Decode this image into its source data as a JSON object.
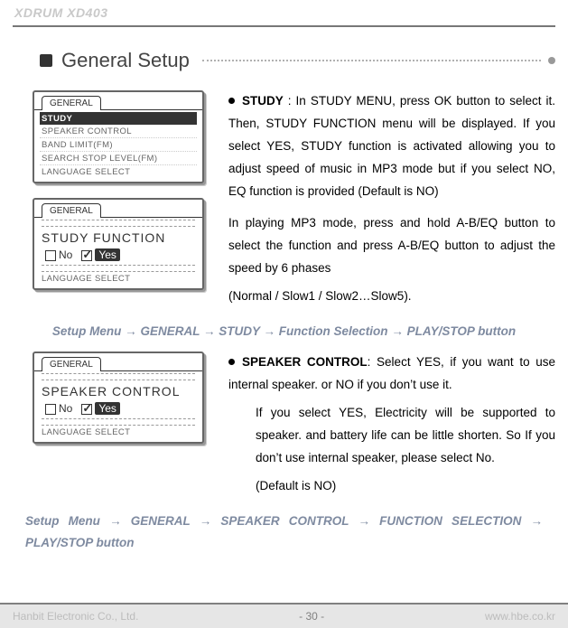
{
  "header": {
    "model": "XDRUM XD403"
  },
  "section_title": "General Setup",
  "screenshots": {
    "tab_label": "GENERAL",
    "menu_lcd": {
      "items": [
        "STUDY",
        "SPEAKER CONTROL",
        "BAND LIMIT(FM)",
        "SEARCH STOP LEVEL(FM)",
        "LANGUAGE SELECT"
      ],
      "selected_index": 0
    },
    "study_lcd": {
      "title": "STUDY FUNCTION",
      "no_label": "No",
      "yes_label": "Yes",
      "footer_item": "LANGUAGE SELECT"
    },
    "speaker_lcd": {
      "title": "SPEAKER CONTROL",
      "no_label": "No",
      "yes_label": "Yes",
      "footer_item": "LANGUAGE SELECT"
    }
  },
  "study": {
    "term": "STUDY",
    "para1": " : In STUDY MENU, press OK button to select it. Then, STUDY FUNCTION menu will be displayed. If you select YES, STUDY function is activated allowing you to adjust speed of music in MP3 mode but if you select NO, EQ function is provided (Default is NO)",
    "para2": "In playing MP3 mode, press and hold A-B/EQ button to select the function and press A-B/EQ button to adjust the speed by 6 phases",
    "para3": "(Normal / Slow1 / Slow2…Slow5)."
  },
  "nav1": {
    "parts": [
      "Setup Menu",
      "GENERAL",
      "STUDY",
      "Function Selection",
      "PLAY/STOP button"
    ]
  },
  "speaker": {
    "term": "SPEAKER CONTROL",
    "para1": ": Select YES, if you want to use internal speaker. or NO if you don’t use it.",
    "para2": "If you select YES, Electricity will be supported to speaker. and battery life can be little shorten. So If you don’t use internal speaker, please select No.",
    "para3": "(Default is NO)"
  },
  "nav2": {
    "parts": [
      "Setup Menu",
      "GENERAL",
      "SPEAKER CONTROL",
      "FUNCTION SELECTION",
      "PLAY/STOP button"
    ]
  },
  "footer": {
    "company": "Hanbit Electronic Co., Ltd.",
    "page": "- 30 -",
    "url": "www.hbe.co.kr"
  },
  "arrow": "→"
}
